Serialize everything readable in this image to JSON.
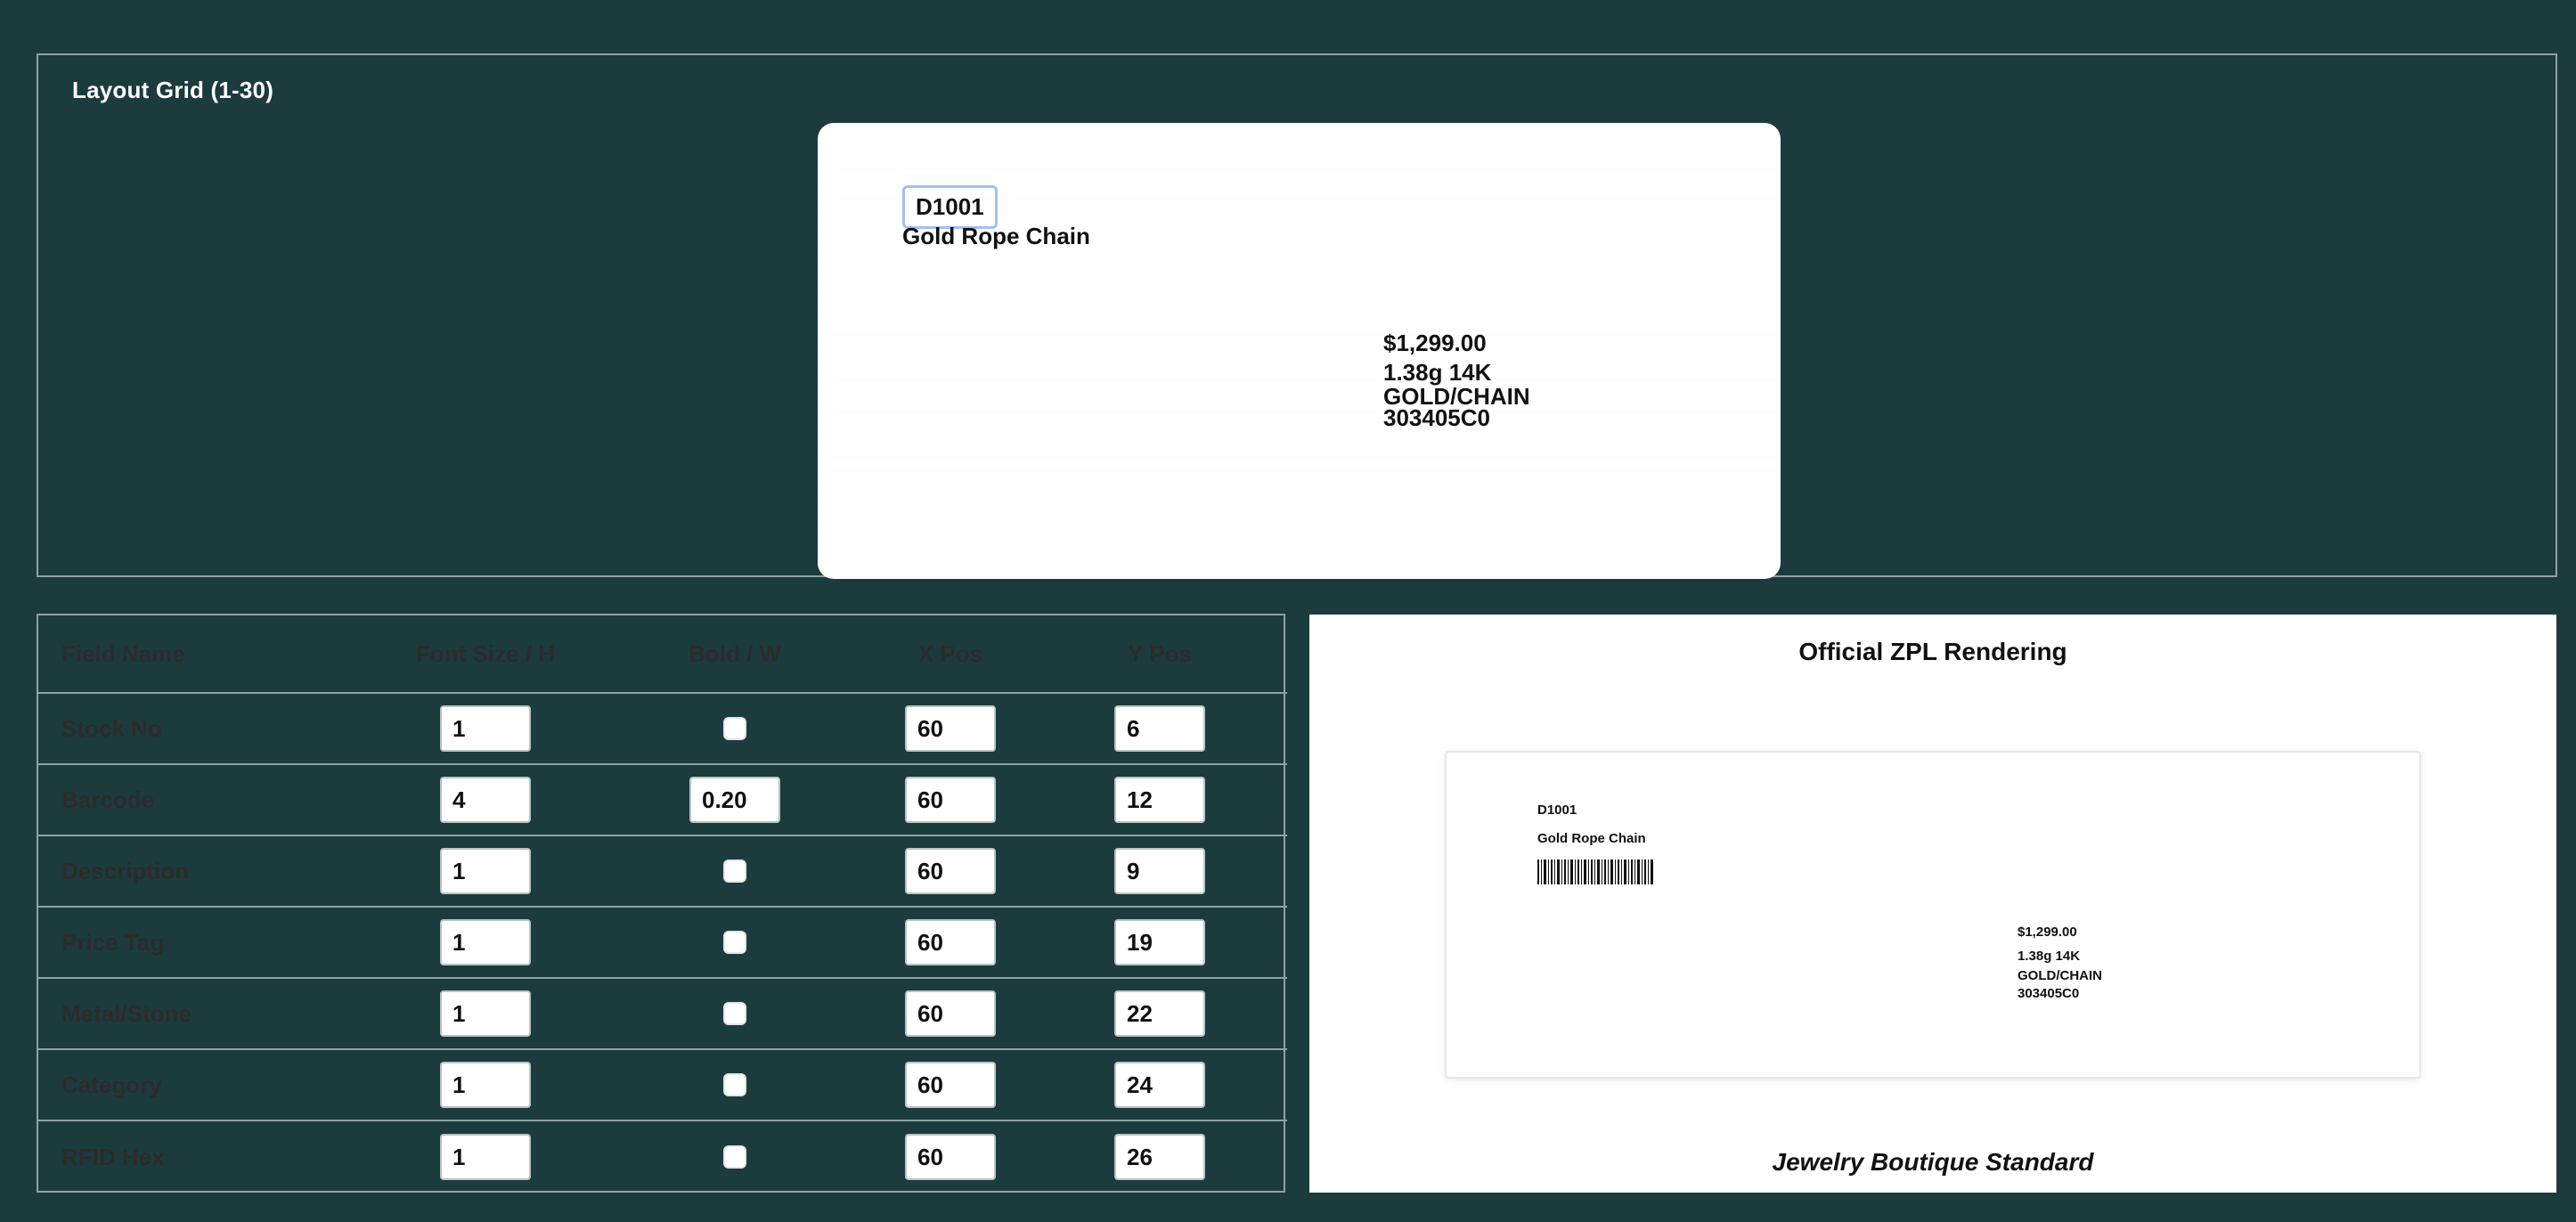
{
  "layout": {
    "title": "Layout Grid (1-30)",
    "preview": {
      "stock_no": "D1001",
      "description": "Gold Rope Chain",
      "price": "$1,299.00",
      "metal_stone": "1.38g 14K",
      "category": "GOLD/CHAIN",
      "rfid_hex": "303405C0"
    }
  },
  "table": {
    "headers": [
      "Field Name",
      "Font Size / H",
      "Bold / W",
      "X Pos",
      "Y Pos"
    ],
    "rows": [
      {
        "name": "Stock No",
        "font_size_h": "1",
        "bold_w": null,
        "x_pos": "60",
        "y_pos": "6"
      },
      {
        "name": "Barcode",
        "font_size_h": "4",
        "bold_w": "0.20",
        "x_pos": "60",
        "y_pos": "12"
      },
      {
        "name": "Description",
        "font_size_h": "1",
        "bold_w": null,
        "x_pos": "60",
        "y_pos": "9"
      },
      {
        "name": "Price Tag",
        "font_size_h": "1",
        "bold_w": null,
        "x_pos": "60",
        "y_pos": "19"
      },
      {
        "name": "Metal/Stone",
        "font_size_h": "1",
        "bold_w": null,
        "x_pos": "60",
        "y_pos": "22"
      },
      {
        "name": "Category",
        "font_size_h": "1",
        "bold_w": null,
        "x_pos": "60",
        "y_pos": "24"
      },
      {
        "name": "RFID Hex",
        "font_size_h": "1",
        "bold_w": null,
        "x_pos": "60",
        "y_pos": "26"
      }
    ]
  },
  "official": {
    "title": "Official ZPL Rendering",
    "card": {
      "stock_no": "D1001",
      "description": "Gold Rope Chain",
      "price": "$1,299.00",
      "metal_stone": "1.38g 14K",
      "category": "GOLD/CHAIN",
      "rfid_hex": "303405C0"
    },
    "footer": "Jewelry Boutique Standard"
  }
}
